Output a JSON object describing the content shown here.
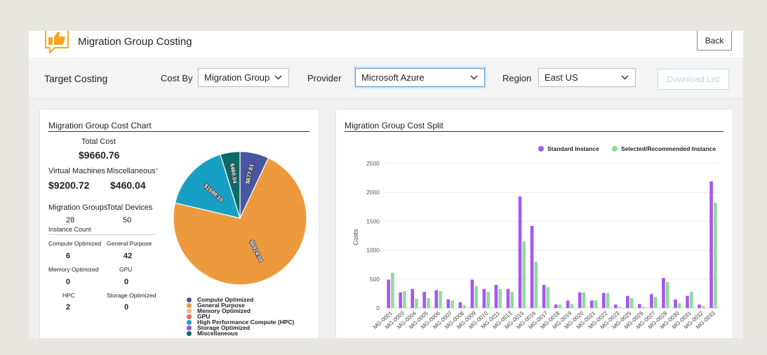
{
  "header": {
    "title": "Migration Group Costing",
    "back_label": "Back"
  },
  "filters": {
    "page_label": "Target Costing",
    "cost_by_label": "Cost By",
    "cost_by_value": "Migration Group",
    "provider_label": "Provider",
    "provider_value": "Microsoft Azure",
    "region_label": "Region",
    "region_value": "East US",
    "download_label": "Download List"
  },
  "cost_chart": {
    "title": "Migration Group Cost Chart",
    "total_cost_label": "Total Cost",
    "total_cost": "$9660.76",
    "vm_label": "Virtual Machines",
    "vm_value": "$9200.72",
    "misc_label": "Miscellaneous",
    "misc_required_mark": "*",
    "misc_value": "$460.04",
    "groups_label": "Migration Groups",
    "groups_value": "28",
    "devices_label": "Total Devices",
    "devices_value": "50",
    "instance_count_label": "Instance Count",
    "counts": [
      {
        "label": "Compute Optimized",
        "value": "6"
      },
      {
        "label": "General Purpose",
        "value": "42"
      },
      {
        "label": "Memory Optimized",
        "value": "0"
      },
      {
        "label": "GPU",
        "value": "0"
      },
      {
        "label": "HPC",
        "value": "2"
      },
      {
        "label": "Storage Optimized",
        "value": "0"
      }
    ]
  },
  "pie_chart": {
    "type": "pie",
    "slices": [
      {
        "name": "Compute Optimized",
        "value": 677.61,
        "label": "$677.61",
        "color": "#4a55a2"
      },
      {
        "name": "General Purpose",
        "value": 6924.04,
        "label": "$6924.04",
        "color": "#ec9a3d"
      },
      {
        "name": "High Performance Compute (HPC)",
        "value": 1599.1,
        "label": "$1599.10",
        "color": "#17a0c4"
      },
      {
        "name": "Miscellaneous",
        "value": 460.04,
        "label": "$460.04",
        "color": "#0d6b66"
      }
    ],
    "legend": [
      {
        "name": "Compute Optimized",
        "color": "#4a55a2"
      },
      {
        "name": "General Purpose",
        "color": "#ec9a3d"
      },
      {
        "name": "Memory Optimized",
        "color": "#f5b98d"
      },
      {
        "name": "GPU",
        "color": "#f06a5a"
      },
      {
        "name": "High Performance Compute (HPC)",
        "color": "#17a0c4"
      },
      {
        "name": "Storage Optimized",
        "color": "#a04fe0"
      },
      {
        "name": "Miscellaneous",
        "color": "#0d6b66"
      }
    ]
  },
  "chart_data": {
    "type": "bar",
    "title": "Migration Group Cost Split",
    "xlabel": "",
    "ylabel": "Costs",
    "ylim": [
      0,
      2500
    ],
    "yticks": [
      0,
      500,
      1000,
      1500,
      2000,
      2500
    ],
    "legend_position": "top-right",
    "categories": [
      "MG-0001",
      "MG-0003",
      "MG-0004",
      "MG-0005",
      "MG-0006",
      "MG-0007",
      "MG-0008",
      "MG-0009",
      "MG-0010",
      "MG-0011",
      "MG-0013",
      "MG-0015",
      "MG-0016",
      "MG-0017",
      "MG-0018",
      "MG-0019",
      "MG-0020",
      "MG-0021",
      "MG-0022",
      "MG-0023",
      "MG-0025",
      "MG-0026",
      "MG-0027",
      "MG-0028",
      "MG-0030",
      "MG-0031",
      "MG-0032",
      "MG-0033"
    ],
    "series": [
      {
        "name": "Standard Instance",
        "color": "#a855f0",
        "values": [
          490,
          270,
          330,
          280,
          310,
          150,
          100,
          490,
          330,
          400,
          330,
          1930,
          1420,
          400,
          60,
          130,
          270,
          130,
          260,
          60,
          210,
          70,
          240,
          520,
          150,
          210,
          60,
          2190
        ]
      },
      {
        "name": "Selected/Recommended Instance",
        "color": "#8fdc9b",
        "values": [
          610,
          290,
          160,
          170,
          290,
          130,
          50,
          380,
          280,
          330,
          280,
          1150,
          800,
          360,
          60,
          70,
          270,
          130,
          260,
          20,
          170,
          20,
          190,
          450,
          80,
          280,
          30,
          1820
        ]
      }
    ]
  }
}
